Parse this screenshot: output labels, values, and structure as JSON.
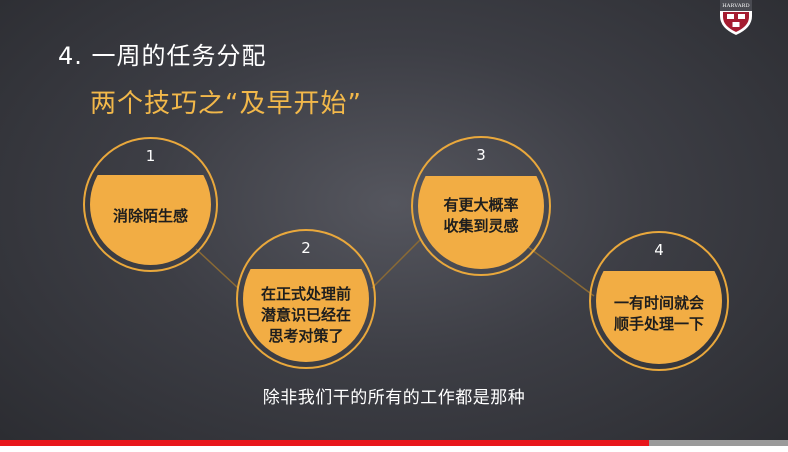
{
  "slide": {
    "title": "4. 一周的任务分配",
    "subtitle": "两个技巧之“及早开始”",
    "logo_text": "HARVARD",
    "steps": [
      {
        "number": "1",
        "lines": [
          "消除陌生感"
        ]
      },
      {
        "number": "2",
        "lines": [
          "在正式处理前",
          "潜意识已经在",
          "思考对策了"
        ]
      },
      {
        "number": "3",
        "lines": [
          "有更大概率",
          "收集到灵感"
        ]
      },
      {
        "number": "4",
        "lines": [
          "一有时间就会",
          "顺手处理一下"
        ]
      }
    ]
  },
  "caption": "除非我们干的所有的工作都是那种",
  "player": {
    "progress_fraction": 0.823,
    "progress_color": "#e8161b"
  },
  "colors": {
    "accent": "#f2b84a",
    "circle_fill": "#f2ad44",
    "background": "#3d3e45"
  }
}
